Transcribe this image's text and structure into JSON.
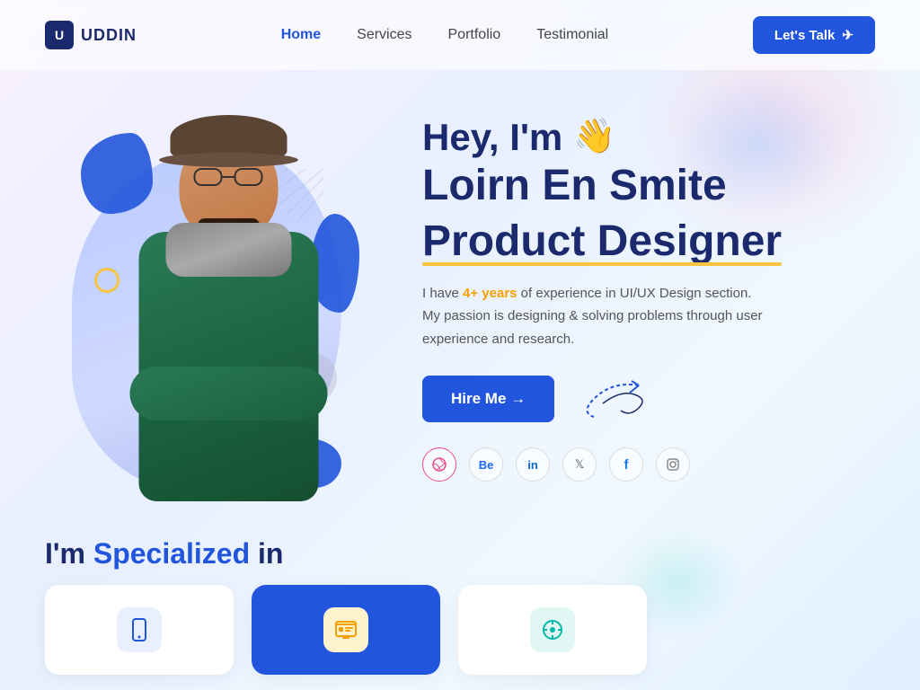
{
  "logo": {
    "icon_letter": "U",
    "text": "UDDIN"
  },
  "navbar": {
    "links": [
      {
        "label": "Home",
        "active": true
      },
      {
        "label": "Services"
      },
      {
        "label": "Portfolio"
      },
      {
        "label": "Testimonial"
      }
    ],
    "cta_button": "Let's Talk"
  },
  "hero": {
    "greeting": "Hey, I'm",
    "wave_emoji": "👋",
    "name": "Loirn En Smite",
    "role": "Product Designer",
    "description_before": "I have ",
    "highlight": "4+ years",
    "description_after": " of experience in UI/UX Design section. My passion is designing & solving problems through user experience and research.",
    "hire_button": "Hire Me →",
    "social_icons": [
      {
        "name": "dribbble",
        "symbol": "⊕"
      },
      {
        "name": "behance",
        "symbol": "Be"
      },
      {
        "name": "linkedin",
        "symbol": "in"
      },
      {
        "name": "twitter",
        "symbol": "𝕏"
      },
      {
        "name": "facebook",
        "symbol": "f"
      },
      {
        "name": "instagram",
        "symbol": "◎"
      }
    ]
  },
  "specialized": {
    "title_before": "I'm ",
    "title_highlight": "Specialized",
    "title_after": " in",
    "cards": [
      {
        "icon": "📱",
        "color": "light"
      },
      {
        "icon": "🖥",
        "color": "blue"
      },
      {
        "icon": "⚙",
        "color": "light"
      }
    ]
  }
}
